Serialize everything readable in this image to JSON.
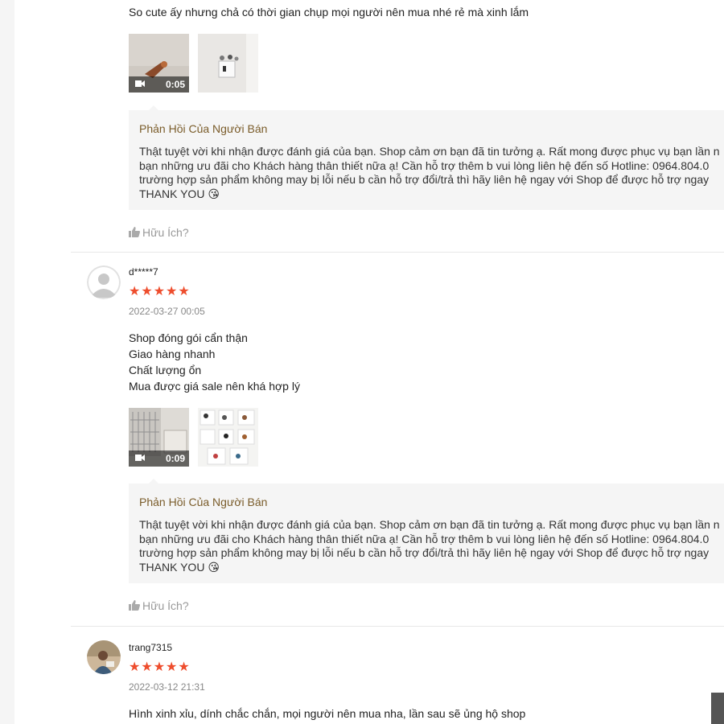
{
  "reviews": [
    {
      "text_lines": [
        "So cute ấy nhưng chả có thời gian chụp mọi người nên mua nhé rẻ mà xinh lắm"
      ],
      "media": [
        {
          "kind": "video",
          "duration": "0:05"
        },
        {
          "kind": "image"
        }
      ],
      "reply": {
        "title": "Phản Hồi Của Người Bán",
        "lines": [
          "Thật tuyệt vời khi nhận được đánh giá của bạn. Shop cảm ơn bạn đã tin tưởng ạ. Rất mong được phục vụ bạn lần n",
          "bạn những ưu đãi cho Khách hàng thân thiết nữa ạ! Cần hỗ trợ thêm b vui lòng liên hệ đến số Hotline: 0964.804.0",
          "trường hợp sản phẩm không may bị lỗi nếu b cần hỗ trợ đổi/trả thì hãy liên hệ ngay với Shop để được hỗ trợ ngay",
          "THANK YOU 😘"
        ]
      },
      "helpful_label": "Hữu Ích?"
    },
    {
      "username": "d*****7",
      "stars": "★★★★★",
      "rating": 5,
      "date": "2022-03-27 00:05",
      "text_lines": [
        "Shop đóng gói cẩn thận",
        "Giao hàng nhanh",
        "Chất lượng ổn",
        "Mua được giá sale nên khá hợp lý"
      ],
      "media": [
        {
          "kind": "video",
          "duration": "0:09"
        },
        {
          "kind": "image"
        }
      ],
      "reply": {
        "title": "Phản Hồi Của Người Bán",
        "lines": [
          "Thật tuyệt vời khi nhận được đánh giá của bạn. Shop cảm ơn bạn đã tin tưởng ạ. Rất mong được phục vụ bạn lần n",
          "bạn những ưu đãi cho Khách hàng thân thiết nữa ạ! Cần hỗ trợ thêm b vui lòng liên hệ đến số Hotline: 0964.804.0",
          "trường hợp sản phẩm không may bị lỗi nếu b cần hỗ trợ đổi/trả thì hãy liên hệ ngay với Shop để được hỗ trợ ngay",
          "THANK YOU 😘"
        ]
      },
      "helpful_label": "Hữu Ích?"
    },
    {
      "username": "trang7315",
      "stars": "★★★★★",
      "rating": 5,
      "date": "2022-03-12 21:31",
      "text_lines": [
        "Hình xinh xỉu,  dính chắc chắn, mọi người nên mua nha, lần sau sẽ ủng hộ shop"
      ]
    }
  ],
  "colors": {
    "star": "#ee4d2d",
    "reply_title": "#7a5c2a",
    "reply_bg": "#f5f5f5",
    "helpful": "#999999"
  },
  "icons": {
    "video_badge": "video-camera-icon",
    "helpful": "thumbs-up-icon",
    "default_avatar": "default-avatar-icon"
  }
}
